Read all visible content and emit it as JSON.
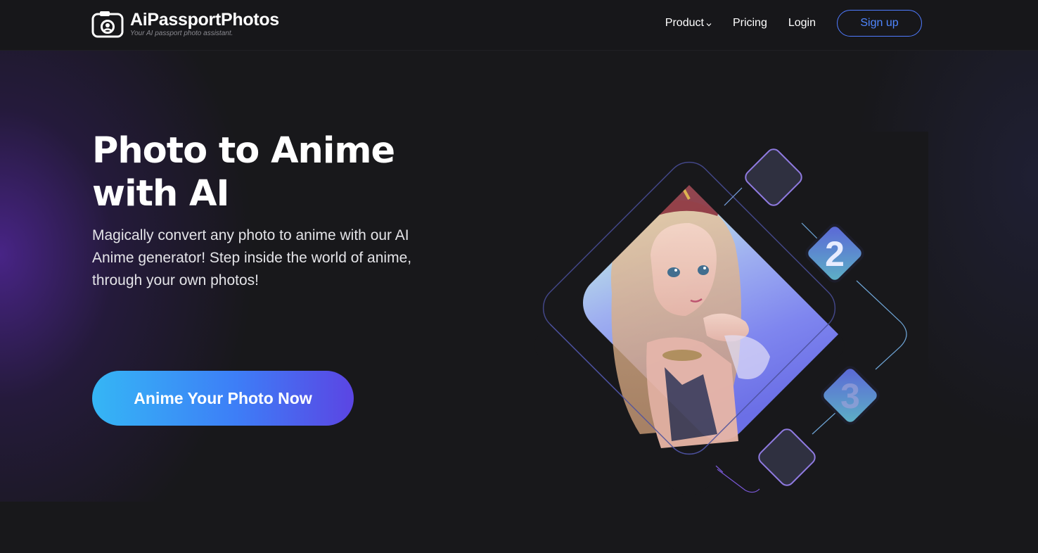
{
  "header": {
    "brand_name": "AiPassportPhotos",
    "brand_tagline": "Your AI passport photo assistant.",
    "nav": {
      "product": "Product",
      "pricing": "Pricing",
      "login": "Login",
      "signup": "Sign up"
    }
  },
  "hero": {
    "title_line1": "Photo to Anime",
    "title_line2": "with AI",
    "subtitle": "Magically convert any photo to anime with our AI Anime generator! Step inside the world of anime, through your own photos!",
    "cta_label": "Anime Your Photo Now",
    "steps": {
      "two": "2",
      "three": "3"
    }
  },
  "colors": {
    "background": "#18181b",
    "accent_blue": "#4f7bff",
    "cta_gradient_start": "#35b6f5",
    "cta_gradient_end": "#5b45e3",
    "glow_purple": "#5828aa"
  },
  "icons": {
    "logo": "camera-icon",
    "product_menu": "chevron-down-icon"
  }
}
